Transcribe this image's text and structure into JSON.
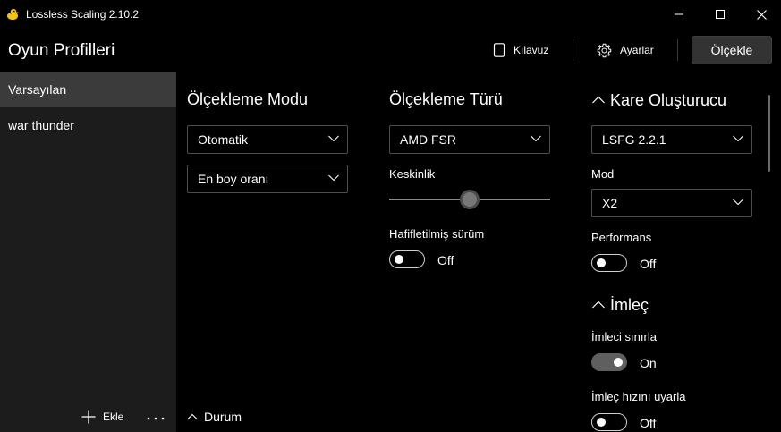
{
  "window": {
    "title": "Lossless Scaling 2.10.2",
    "icon": "duck-icon"
  },
  "header": {
    "title": "Oyun Profilleri",
    "guide_label": "Kılavuz",
    "settings_label": "Ayarlar",
    "scale_label": "Ölçekle"
  },
  "sidebar": {
    "profiles": [
      {
        "label": "Varsayılan",
        "selected": true
      },
      {
        "label": "war thunder",
        "selected": false
      }
    ],
    "add_label": "Ekle"
  },
  "scaling_mode": {
    "title": "Ölçekleme Modu",
    "mode_value": "Otomatik",
    "aspect_value": "En boy oranı"
  },
  "scaling_type": {
    "title": "Ölçekleme Türü",
    "type_value": "AMD FSR",
    "sharpness_label": "Keskinlik",
    "sharpness_level": 0.5,
    "lite_label": "Hafifletilmiş sürüm",
    "lite_state": "Off"
  },
  "frame_gen": {
    "title": "Kare Oluşturucu",
    "value": "LSFG 2.2.1",
    "mode_label": "Mod",
    "mode_value": "X2",
    "performance_label": "Performans",
    "performance_state": "Off"
  },
  "cursor": {
    "title": "İmleç",
    "clip_label": "İmleci sınırla",
    "clip_state": "On",
    "adjust_speed_label": "İmleç hızını uyarla",
    "adjust_speed_state": "Off"
  },
  "status": {
    "label": "Durum"
  }
}
